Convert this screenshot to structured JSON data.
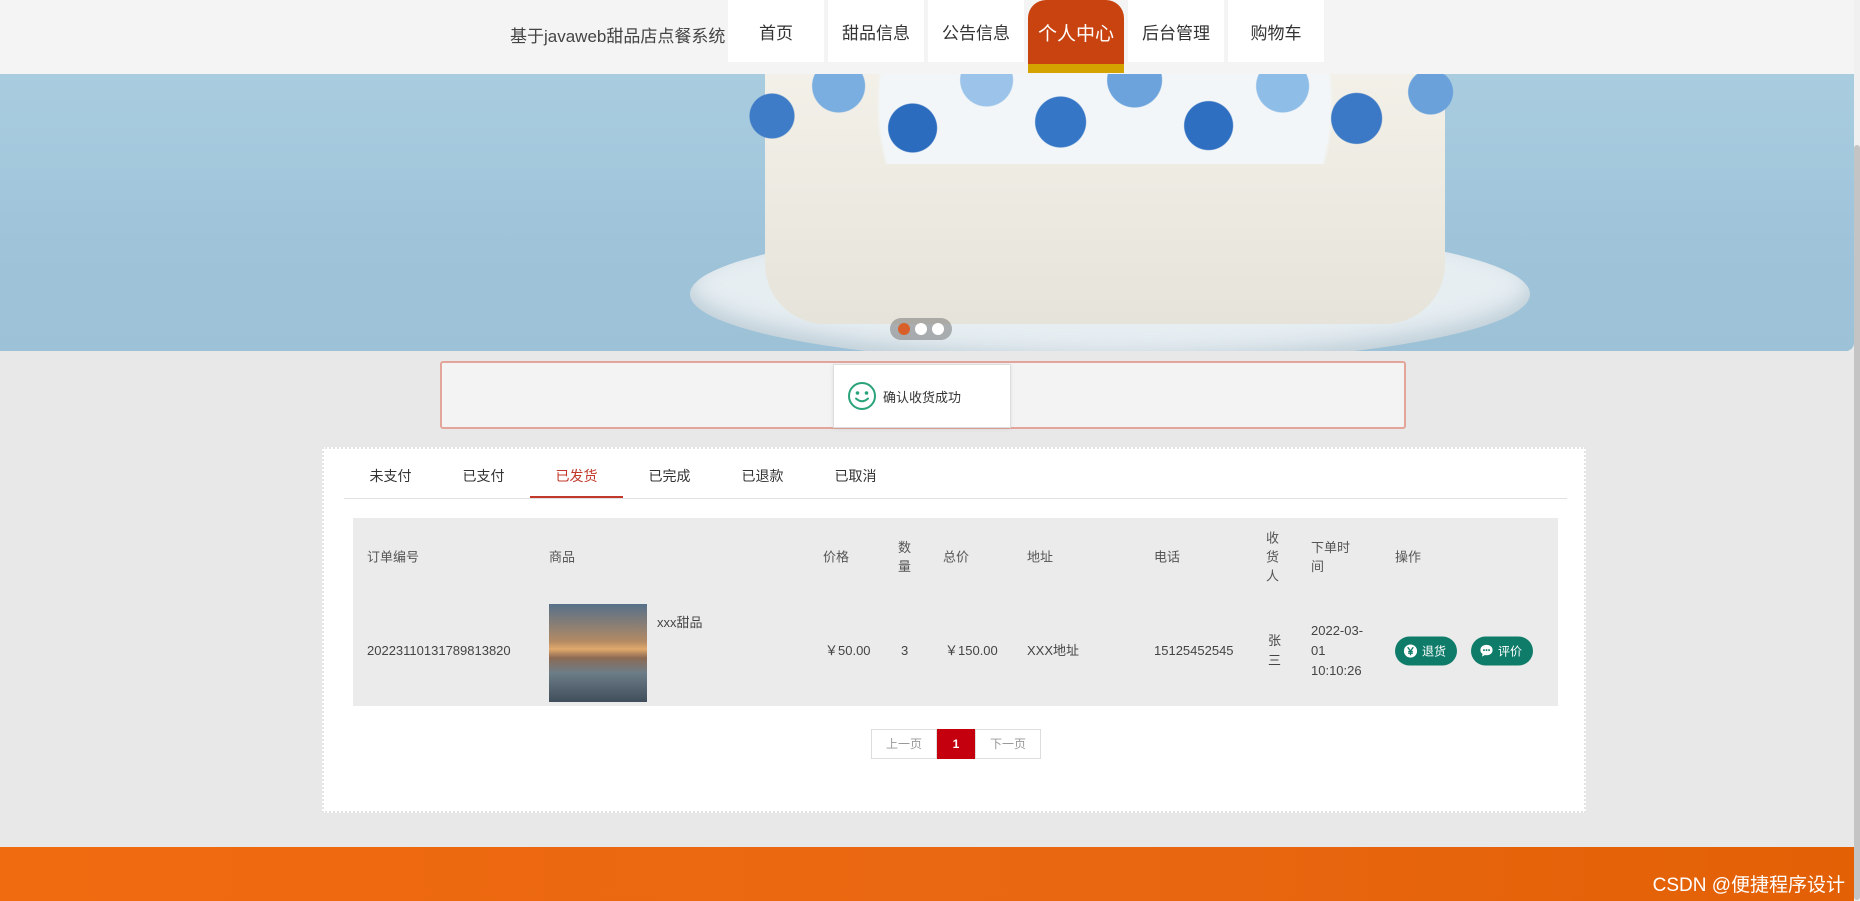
{
  "header": {
    "site_title": "基于javaweb甜品店点餐系统",
    "nav": [
      "首页",
      "甜品信息",
      "公告信息",
      "个人中心",
      "后台管理",
      "购物车"
    ],
    "active_nav": "个人中心"
  },
  "carousel": {
    "slide_count": 3,
    "active_index": 0
  },
  "toast": {
    "icon": "smile-icon",
    "message": "确认收货成功"
  },
  "order_tabs": [
    "未支付",
    "已支付",
    "已发货",
    "已完成",
    "已退款",
    "已取消"
  ],
  "active_tab": "已发货",
  "table": {
    "headers": {
      "order_no": "订单编号",
      "product": "商品",
      "price": "价格",
      "qty": "数量",
      "total": "总价",
      "address": "地址",
      "phone": "电话",
      "receiver": "收货人",
      "order_time": "下单时间",
      "actions": "操作"
    },
    "rows": [
      {
        "order_no": "20223110131789813820",
        "product_name": "xxx甜品",
        "price": "￥50.00",
        "qty": "3",
        "total": "￥150.00",
        "address": "XXX地址",
        "phone": "15125452545",
        "receiver": "张三",
        "order_time": "2022-03-01 10:10:26",
        "refund_label": "退货",
        "review_label": "评价"
      }
    ]
  },
  "pagination": {
    "prev": "上一页",
    "current": "1",
    "next": "下一页"
  },
  "watermark": "CSDN @便捷程序设计",
  "colors": {
    "accent": "#c8430f",
    "tab_active": "#c0392b",
    "button": "#0f7c6a",
    "footer": "#f06a10"
  }
}
